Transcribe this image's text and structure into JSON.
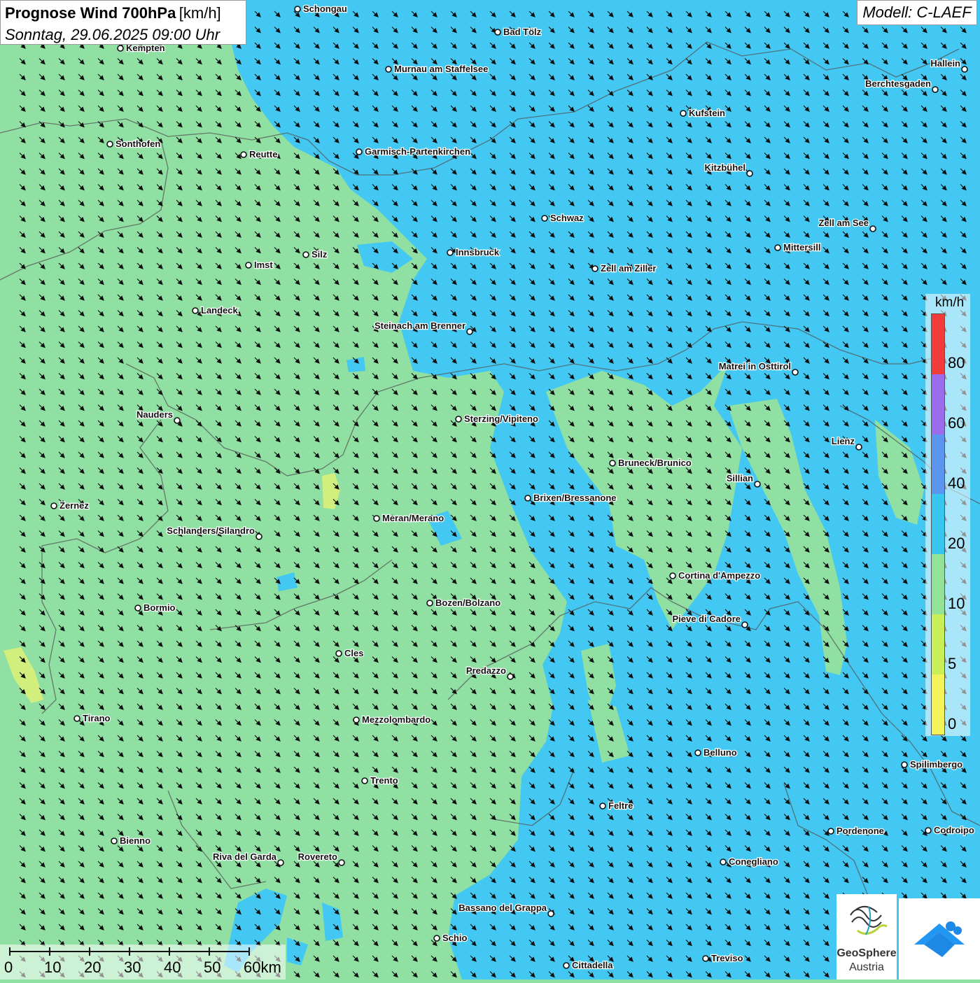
{
  "header": {
    "title": "Prognose Wind 700hPa",
    "unit": "[km/h]",
    "date": "Sonntag, 29.06.2025 09:00 Uhr",
    "model": "Modell: C-LAEF"
  },
  "legend": {
    "unit": "km/h",
    "ticks": [
      "80",
      "60",
      "40",
      "20",
      "10",
      "5",
      "0"
    ],
    "colors": [
      "#f23c3c",
      "#9a6bea",
      "#5b95f0",
      "#36c6ef",
      "#92e398",
      "#c8ef58",
      "#f2f25a"
    ]
  },
  "scalebar": {
    "labels": [
      "0",
      "10",
      "20",
      "30",
      "40",
      "50",
      "60km"
    ]
  },
  "logo": {
    "name_line1": "GeoSphere",
    "name_line2": "Austria"
  },
  "cities": [
    {
      "name": "Schongau",
      "id": "schongau"
    },
    {
      "name": "Bad Tölz",
      "id": "bad-toelz"
    },
    {
      "name": "Kempten",
      "id": "kempten"
    },
    {
      "name": "Murnau am Staffelsee",
      "id": "murnau"
    },
    {
      "name": "Hallein",
      "id": "hallein"
    },
    {
      "name": "Berchtesgaden",
      "id": "berchtesgaden"
    },
    {
      "name": "Kufstein",
      "id": "kufstein"
    },
    {
      "name": "Sonthofen",
      "id": "sonthofen"
    },
    {
      "name": "Reutte",
      "id": "reutte"
    },
    {
      "name": "Garmisch-Partenkirchen",
      "id": "garmisch"
    },
    {
      "name": "Kitzbühel",
      "id": "kitzbuehel"
    },
    {
      "name": "Schwaz",
      "id": "schwaz"
    },
    {
      "name": "Zell am See",
      "id": "zell-am-see"
    },
    {
      "name": "Innsbruck",
      "id": "innsbruck"
    },
    {
      "name": "Mittersill",
      "id": "mittersill"
    },
    {
      "name": "Silz",
      "id": "silz"
    },
    {
      "name": "Imst",
      "id": "imst"
    },
    {
      "name": "Zell am Ziller",
      "id": "zell-am-ziller"
    },
    {
      "name": "Landeck",
      "id": "landeck"
    },
    {
      "name": "Steinach am Brenner",
      "id": "steinach"
    },
    {
      "name": "Matrei in Osttirol",
      "id": "matrei"
    },
    {
      "name": "Nauders",
      "id": "nauders"
    },
    {
      "name": "Sterzing/Vipiteno",
      "id": "sterzing"
    },
    {
      "name": "Lienz",
      "id": "lienz"
    },
    {
      "name": "Bruneck/Brunico",
      "id": "bruneck"
    },
    {
      "name": "Sillian",
      "id": "sillian"
    },
    {
      "name": "Brixen/Bressanone",
      "id": "brixen"
    },
    {
      "name": "Zernez",
      "id": "zernez"
    },
    {
      "name": "Meran/Merano",
      "id": "meran"
    },
    {
      "name": "Schlanders/Silandro",
      "id": "schlanders"
    },
    {
      "name": "Cortina d'Ampezzo",
      "id": "cortina"
    },
    {
      "name": "Bozen/Bolzano",
      "id": "bozen"
    },
    {
      "name": "Bormio",
      "id": "bormio"
    },
    {
      "name": "Pieve di Cadore",
      "id": "pieve"
    },
    {
      "name": "Cles",
      "id": "cles"
    },
    {
      "name": "Predazzo",
      "id": "predazzo"
    },
    {
      "name": "Tirano",
      "id": "tirano"
    },
    {
      "name": "Mezzolombardo",
      "id": "mezzolombardo"
    },
    {
      "name": "Belluno",
      "id": "belluno"
    },
    {
      "name": "Spilimbergo",
      "id": "spilimbergo"
    },
    {
      "name": "Trento",
      "id": "trento"
    },
    {
      "name": "Feltre",
      "id": "feltre"
    },
    {
      "name": "Bienno",
      "id": "bienno"
    },
    {
      "name": "Pordenone",
      "id": "pordenone"
    },
    {
      "name": "Codroipo",
      "id": "codroipo"
    },
    {
      "name": "Riva del Garda",
      "id": "riva"
    },
    {
      "name": "Rovereto",
      "id": "rovereto"
    },
    {
      "name": "Conegliano",
      "id": "conegliano"
    },
    {
      "name": "Bassano del Grappa",
      "id": "bassano"
    },
    {
      "name": "Schio",
      "id": "schio"
    },
    {
      "name": "Cittadella",
      "id": "cittadella"
    },
    {
      "name": "Treviso",
      "id": "treviso"
    }
  ]
}
